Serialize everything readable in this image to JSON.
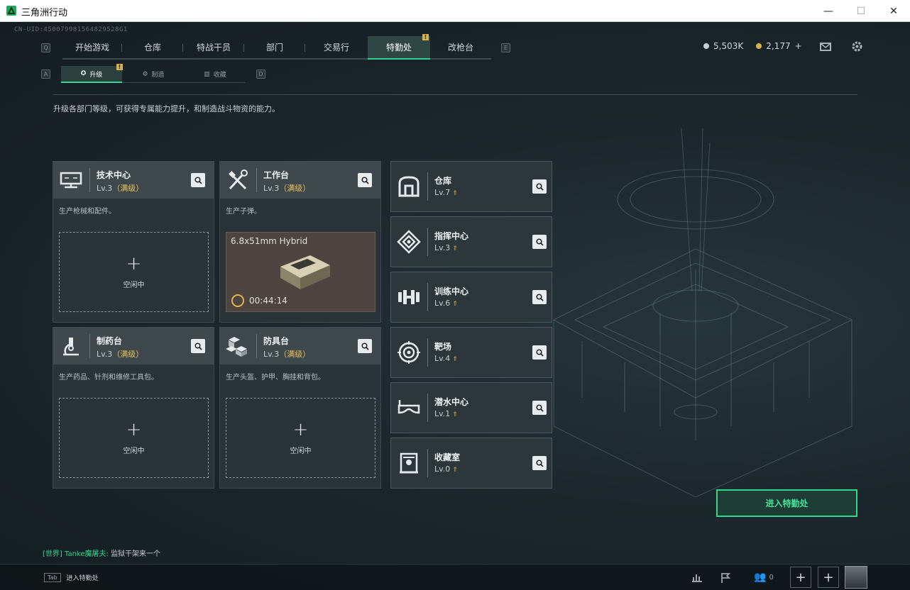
{
  "window": {
    "title": "三角洲行动",
    "minimize": "—",
    "maximize": "☐",
    "close": "✕"
  },
  "uid": "CN-UID:450079981564829528G1",
  "nav": {
    "left_key": "Q",
    "right_key": "E",
    "tabs": [
      "开始游戏",
      "仓库",
      "特战干员",
      "部门",
      "交易行",
      "特勤处",
      "改枪台"
    ],
    "active": "特勤处",
    "badge": "!"
  },
  "currency": {
    "silver": "5,503K",
    "gold": "2,177",
    "gold_add": "+"
  },
  "subnav": {
    "left_key": "A",
    "right_key": "D",
    "tabs": [
      "升级",
      "制造",
      "收藏"
    ],
    "badge": "!"
  },
  "description": "升级各部门等级，可获得专属能力提升，和制造战斗物资的能力。",
  "cards": [
    {
      "name": "技术中心",
      "level": "Lv.3",
      "max": "（满级）",
      "desc": "生产枪械和配件。",
      "state": "空闲中",
      "icon": "computer-icon"
    },
    {
      "name": "工作台",
      "level": "Lv.3",
      "max": "（满级）",
      "desc": "生产子弹。",
      "state": "crafting",
      "icon": "tools-icon",
      "crafting": {
        "item": "6.8x51mm Hybrid",
        "timer": "00:44:14"
      }
    },
    {
      "name": "制药台",
      "level": "Lv.3",
      "max": "（满级）",
      "desc": "生产药品、针剂和维修工具包。",
      "state": "空闲中",
      "icon": "microscope-icon"
    },
    {
      "name": "防具台",
      "level": "Lv.3",
      "max": "（满级）",
      "desc": "生产头盔、护甲、胸挂和背包。",
      "state": "空闲中",
      "icon": "armor-blocks-icon"
    }
  ],
  "rooms": [
    {
      "name": "仓库",
      "level": "Lv.7",
      "icon": "warehouse-icon"
    },
    {
      "name": "指挥中心",
      "level": "Lv.3",
      "icon": "command-icon"
    },
    {
      "name": "训练中心",
      "level": "Lv.6",
      "icon": "dumbbell-icon"
    },
    {
      "name": "靶场",
      "level": "Lv.4",
      "icon": "target-icon"
    },
    {
      "name": "潜水中心",
      "level": "Lv.1",
      "icon": "diving-mask-icon"
    },
    {
      "name": "收藏室",
      "level": "Lv.0",
      "icon": "display-case-icon"
    }
  ],
  "enter_button": "进入特勤处",
  "chat": {
    "channel": "[世界]",
    "user": "Tanke魔屠夫:",
    "message": "监狱干架来一个"
  },
  "bottom": {
    "tab_key": "Tab",
    "tab_label": "进入特勤处",
    "friends_count": "0"
  },
  "colors": {
    "accent": "#2fd78f",
    "gold": "#e8c25b",
    "panel": "#2a3438"
  }
}
